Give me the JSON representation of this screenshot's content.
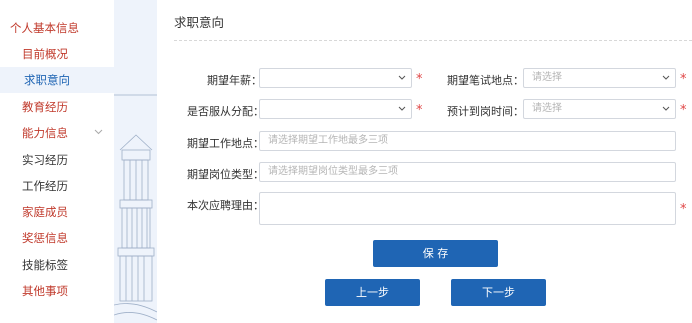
{
  "sidebar": {
    "items": [
      {
        "label": "个人基本信息",
        "color": "#c0392b"
      },
      {
        "label": "目前概况",
        "color": "#c0392b"
      },
      {
        "label": "求职意向",
        "color": "#1f65b4"
      },
      {
        "label": "教育经历",
        "color": "#c0392b"
      },
      {
        "label": "能力信息",
        "color": "#c0392b"
      },
      {
        "label": "实习经历",
        "color": "#333333"
      },
      {
        "label": "工作经历",
        "color": "#333333"
      },
      {
        "label": "家庭成员",
        "color": "#c0392b"
      },
      {
        "label": "奖惩信息",
        "color": "#c0392b"
      },
      {
        "label": "技能标签",
        "color": "#333333"
      },
      {
        "label": "其他事项",
        "color": "#c0392b"
      }
    ],
    "expand_icon": "chevron-down-icon"
  },
  "main": {
    "title": "求职意向",
    "form": {
      "expected_salary": {
        "label": "期望年薪：",
        "value": ""
      },
      "written_test_location": {
        "label": "期望笔试地点：",
        "placeholder": "请选择"
      },
      "accept_assignment": {
        "label": "是否服从分配：",
        "value": ""
      },
      "expected_start_time": {
        "label": "预计到岗时间：",
        "placeholder": "请选择"
      },
      "expected_work_location": {
        "label": "期望工作地点：",
        "placeholder": "请选择期望工作地最多三项"
      },
      "expected_position_type": {
        "label": "期望岗位类型：",
        "placeholder": "请选择期望岗位类型最多三项"
      },
      "application_reason": {
        "label": "本次应聘理由：",
        "value": ""
      },
      "required_mark": "*"
    },
    "buttons": {
      "save": "保 存",
      "prev": "上一步",
      "next": "下一步"
    }
  },
  "colors": {
    "accent": "#1f65b4",
    "required": "#e04545",
    "menu_red": "#c0392b"
  }
}
